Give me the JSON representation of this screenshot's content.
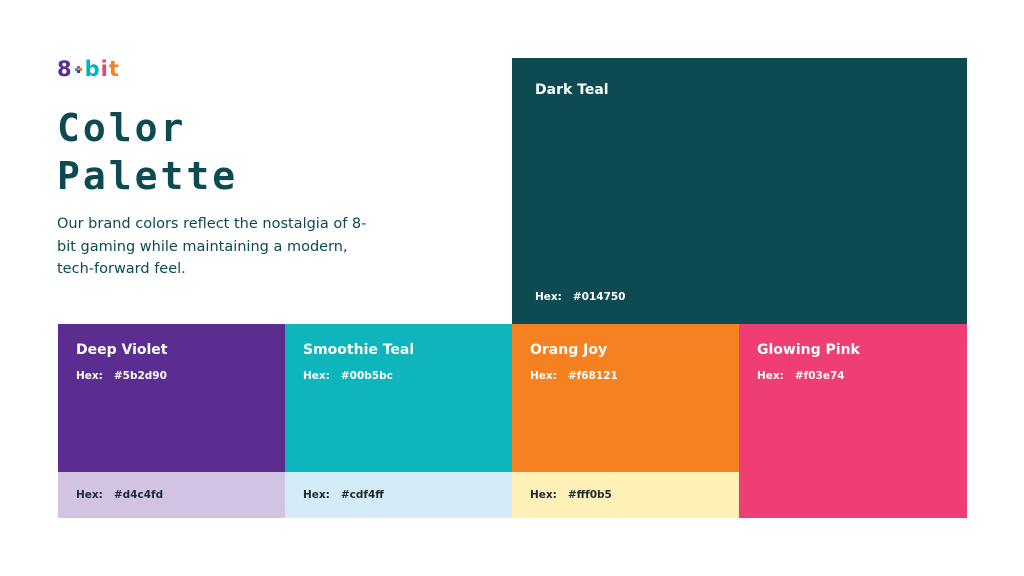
{
  "logo": {
    "eight": "8",
    "b": "b",
    "i": "i",
    "t": "t"
  },
  "title": {
    "line1": "Color",
    "line2": "Palette"
  },
  "description": "Our brand colors reflect the nostalgia of 8-bit gaming while maintaining a modern, tech-forward feel.",
  "hex_prefix": "Hex:",
  "main_swatches": [
    {
      "name": "Dark Teal",
      "hex": "#014750",
      "color": "#0d4a52"
    },
    {
      "name": "Deep Violet",
      "hex": "#5b2d90",
      "color": "#5b2d90"
    },
    {
      "name": "Smoothie Teal",
      "hex": "#00b5bc",
      "color": "#0fb5bc"
    },
    {
      "name": "Orang Joy",
      "hex": "#f68121",
      "color": "#f68121"
    },
    {
      "name": "Glowing Pink",
      "hex": "#f03e74",
      "color": "#ef3e74"
    }
  ],
  "tint_swatches": [
    {
      "hex": "#d4c4fd",
      "color": "#d3c3e3"
    },
    {
      "hex": "#cdf4ff",
      "color": "#d3ecf7"
    },
    {
      "hex": "#fff0b5",
      "color": "#fff0b8"
    }
  ]
}
